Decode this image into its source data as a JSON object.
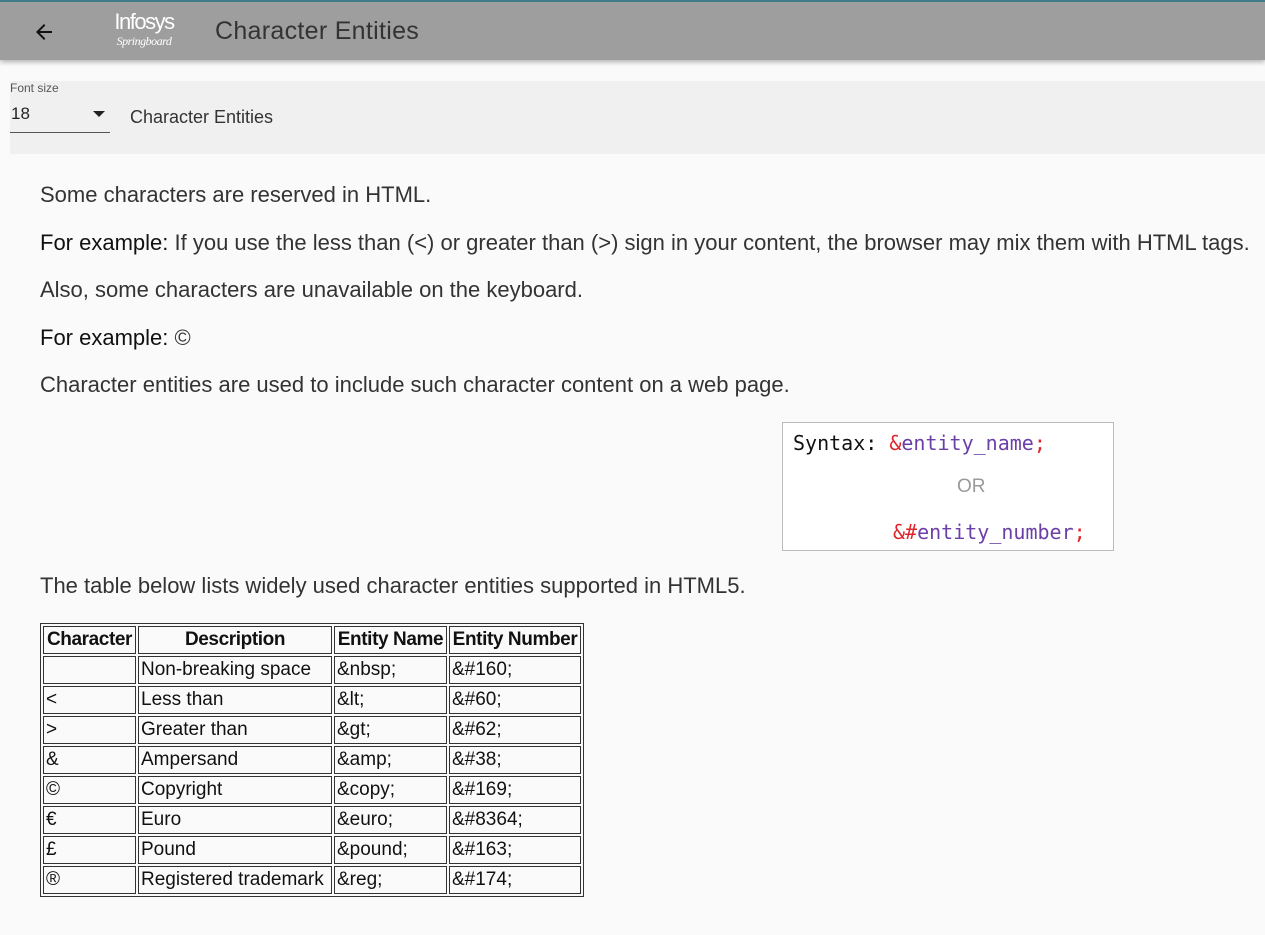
{
  "header": {
    "logo_line1": "Infosys",
    "logo_line2": "Springboard",
    "title": "Character Entities"
  },
  "toolbar": {
    "font_size_label": "Font size",
    "font_size_value": "18",
    "title": "Character Entities"
  },
  "content": {
    "p1": "Some characters are reserved in HTML.",
    "p2_bold": "For example:",
    "p2_text": " If you use the less than (<) or greater than (>) sign in your content, the browser may mix them with HTML tags.",
    "p3": "Also, some characters are unavailable on the keyboard.",
    "p4_bold": "For example:",
    "p4_text": " ©",
    "p5": "Character entities are used to include such character content on a web page.",
    "p6": "The table below lists widely used character entities supported in HTML5."
  },
  "syntax": {
    "label": "Syntax: ",
    "name_amp": "&",
    "name_text": "entity_name",
    "name_semi": ";",
    "or": "OR",
    "num_amp": "&#",
    "num_text": "entity_number",
    "num_semi": ";"
  },
  "table": {
    "headers": [
      "Character",
      "Description",
      "Entity Name",
      "Entity Number"
    ],
    "rows": [
      [
        " ",
        "Non-breaking space",
        "&nbsp;",
        "&#160;"
      ],
      [
        "<",
        "Less than",
        "&lt;",
        "&#60;"
      ],
      [
        ">",
        "Greater than",
        "&gt;",
        "&#62;"
      ],
      [
        "&",
        "Ampersand",
        "&amp;",
        "&#38;"
      ],
      [
        "©",
        "Copyright",
        "&copy;",
        "&#169;"
      ],
      [
        "€",
        "Euro",
        "&euro;",
        "&#8364;"
      ],
      [
        "£",
        "Pound",
        "&pound;",
        "&#163;"
      ],
      [
        "®",
        "Registered trademark",
        "&reg;",
        "&#174;"
      ]
    ]
  },
  "colors": {
    "header_bg": "#9e9e9e",
    "entity_red": "#e0242a",
    "entity_purple": "#6c3fa8"
  },
  "icons": {
    "back": "arrow-left-icon",
    "dropdown": "caret-down-icon"
  }
}
